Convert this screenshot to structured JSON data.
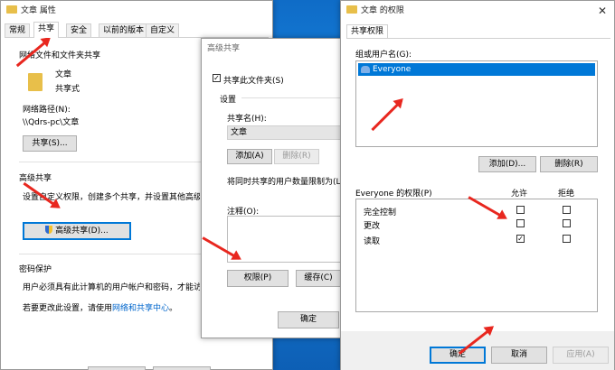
{
  "props_window": {
    "title": "文章 属性",
    "tabs": [
      "常规",
      "共享",
      "安全",
      "以前的版本",
      "自定义"
    ],
    "net_section_title": "网络文件和文件夹共享",
    "folder_name": "文章",
    "folder_state": "共享式",
    "path_label": "网络路径(N):",
    "path_value": "\\\\Qdrs-pc\\文章",
    "share_button": "共享(S)...",
    "adv_section_title": "高级共享",
    "adv_desc": "设置自定义权限，创建多个共享，并设置其他高级共",
    "adv_button": "高级共享(D)...",
    "pwd_section_title": "密码保护",
    "pwd_desc": "用户必须具有此计算机的用户帐户和密码，才能访问",
    "pwd_change": "若要更改此设置，请使用",
    "pwd_link": "网络和共享中心",
    "pwd_end": "。"
  },
  "adv_window": {
    "title": "高级共享",
    "share_checkbox": "共享此文件夹(S)",
    "settings_label": "设置",
    "share_name_label": "共享名(H):",
    "share_name_value": "文章",
    "add_button": "添加(A)",
    "remove_button": "删除(R)",
    "limit_label": "将同时共享的用户数量限制为(L):",
    "comment_label": "注释(O):",
    "perm_button": "权限(P)",
    "cache_button": "缓存(C)",
    "ok_button": "确定"
  },
  "perm_window": {
    "title": "文章 的权限",
    "tab": "共享权限",
    "group_label": "组或用户名(G):",
    "user": "Everyone",
    "add_button": "添加(D)...",
    "remove_button": "删除(R)",
    "perm_label": "Everyone 的权限(P)",
    "allow_header": "允许",
    "deny_header": "拒绝",
    "rows": [
      {
        "name": "完全控制",
        "allow": false,
        "deny": false
      },
      {
        "name": "更改",
        "allow": false,
        "deny": false
      },
      {
        "name": "读取",
        "allow": true,
        "deny": false
      }
    ],
    "ok_button": "确定",
    "cancel_button": "取消",
    "apply_button": "应用(A)"
  },
  "colors": {
    "accent": "#0078d7",
    "arrow": "#e8271f",
    "selection": "#0078d7"
  }
}
